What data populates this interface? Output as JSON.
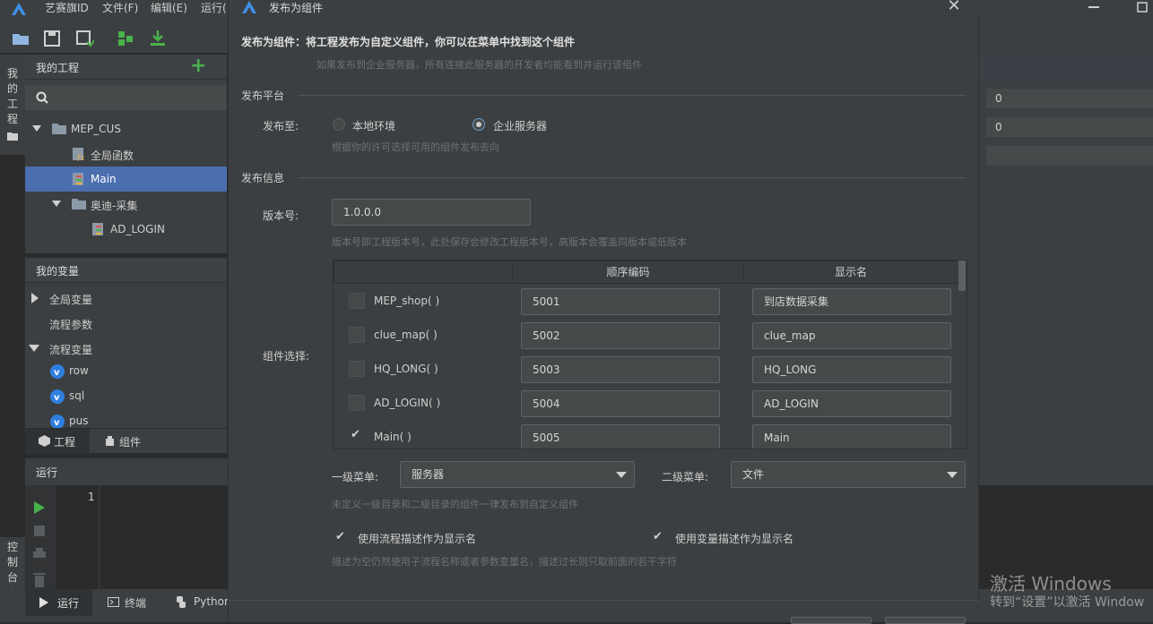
{
  "app": {
    "title": "艺赛旗ID",
    "menus": [
      "文件(F)",
      "编辑(E)",
      "运行("
    ]
  },
  "left_strip": {
    "project_chars": [
      "我",
      "的",
      "工",
      "程"
    ],
    "console_chars": [
      "控",
      "制",
      "台"
    ]
  },
  "project_panel": {
    "title": "我的工程",
    "add_label": "+",
    "items": [
      {
        "label": "MEP_CUS"
      },
      {
        "label": "全局函数"
      },
      {
        "label": "Main"
      },
      {
        "label": "奥迪-采集"
      },
      {
        "label": "AD_LOGIN"
      }
    ]
  },
  "variables_panel": {
    "title": "我的变量",
    "items": [
      {
        "label": "全局变量"
      },
      {
        "label": "流程参数"
      },
      {
        "label": "流程变量"
      },
      {
        "label": "row"
      },
      {
        "label": "sql"
      },
      {
        "label": "pus"
      }
    ]
  },
  "side_tabs": {
    "project": "工程",
    "component": "组件"
  },
  "run_panel": {
    "title": "运行",
    "line_number": "1"
  },
  "bottom_tabs": {
    "run": "运行",
    "terminal": "终端",
    "python": "Pythor"
  },
  "right_pane": {
    "field1": "0",
    "field2": "0"
  },
  "watermark": {
    "line1": "激活 Windows",
    "line2": "转到“设置”以激活 Window"
  },
  "dialog": {
    "title": "发布为组件",
    "heading": "发布为组件：将工程发布为自定义组件，你可以在菜单中找到这个组件",
    "heading_hint": "如果发布到企业服务器，所有连接此服务器的开发者均能看到并运行该组件",
    "section_platform": "发布平台",
    "publish_to_label": "发布至:",
    "radio_local": "本地环境",
    "radio_server": "企业服务器",
    "publish_hint": "根据你的许可选择可用的组件发布去向",
    "section_info": "发布信息",
    "version_label": "版本号:",
    "version_value": "1.0.0.0",
    "version_hint": "版本号即工程版本号，此处保存会修改工程版本号，高版本会覆盖同版本或低版本",
    "component_select_label": "组件选择:",
    "table": {
      "headers": [
        "",
        "顺序编码",
        "显示名"
      ],
      "rows": [
        {
          "name": "MEP_shop( )",
          "code": "5001",
          "display": "到店数据采集",
          "checked": false
        },
        {
          "name": "clue_map( )",
          "code": "5002",
          "display": "clue_map",
          "checked": false
        },
        {
          "name": "HQ_LONG( )",
          "code": "5003",
          "display": "HQ_LONG",
          "checked": false
        },
        {
          "name": "AD_LOGIN( )",
          "code": "5004",
          "display": "AD_LOGIN",
          "checked": false
        },
        {
          "name": "Main( )",
          "code": "5005",
          "display": "Main",
          "checked": true
        }
      ]
    },
    "menu1_label": "一级菜单:",
    "menu1_value": "服务器",
    "menu2_label": "二级菜单:",
    "menu2_value": "文件",
    "menu_hint": "未定义一级目录和二级目录的组件一律发布到自定义组件",
    "use_flow_desc": "使用流程描述作为显示名",
    "use_var_desc": "使用变量描述作为显示名",
    "desc_hint": "描述为空仍然使用子流程名称或者参数变量名，描述过长则只取前面的若干字符"
  },
  "colors": {
    "accent": "#4b6eaf",
    "run_green": "#49b24b",
    "add_green": "#4caf50"
  }
}
